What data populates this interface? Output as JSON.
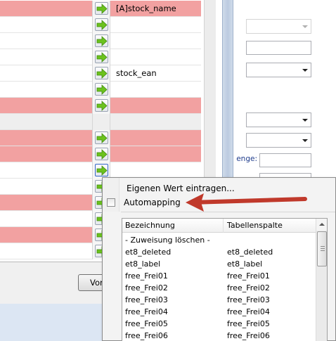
{
  "mapping_grid": {
    "rows": [
      {
        "style": "pink",
        "has_arrow": true,
        "focused": false,
        "target": "[A]stock_name"
      },
      {
        "style": "white",
        "has_arrow": true,
        "focused": false,
        "target": ""
      },
      {
        "style": "white",
        "has_arrow": true,
        "focused": false,
        "target": ""
      },
      {
        "style": "white",
        "has_arrow": true,
        "focused": false,
        "target": ""
      },
      {
        "style": "white",
        "has_arrow": true,
        "focused": false,
        "target": "stock_ean"
      },
      {
        "style": "white",
        "has_arrow": true,
        "focused": false,
        "target": ""
      },
      {
        "style": "pink",
        "has_arrow": true,
        "focused": false,
        "target": ""
      },
      {
        "style": "gray",
        "has_arrow": false,
        "focused": false,
        "target": ""
      },
      {
        "style": "pink",
        "has_arrow": true,
        "focused": false,
        "target": ""
      },
      {
        "style": "pink",
        "has_arrow": true,
        "focused": false,
        "target": ""
      },
      {
        "style": "white",
        "has_arrow": true,
        "focused": true,
        "target": ""
      },
      {
        "style": "white",
        "has_arrow": true,
        "focused": false,
        "target": ""
      },
      {
        "style": "pink",
        "has_arrow": true,
        "focused": false,
        "target": ""
      },
      {
        "style": "white",
        "has_arrow": true,
        "focused": false,
        "target": ""
      },
      {
        "style": "pink",
        "has_arrow": true,
        "focused": false,
        "target": ""
      },
      {
        "style": "white",
        "has_arrow": true,
        "focused": false,
        "target": ""
      }
    ],
    "colors": {
      "unmapped_row": "#f2a1a1",
      "section_row": "#eeeeee",
      "arrow_green": "#6cc21d"
    },
    "arrow_icon": "arrow-right-icon"
  },
  "buttons": {
    "vor_label": "Vor"
  },
  "right_panel": {
    "menge_label": "enge:"
  },
  "popup": {
    "menu": {
      "custom_value_label": "Eigenen Wert eintragen...",
      "automapping_label": "Automapping",
      "automapping_checked": false
    },
    "list": {
      "header_name": "Bezeichnung",
      "header_column": "Tabellenspalte",
      "rows": [
        {
          "name": "- Zuweisung löschen -",
          "column": ""
        },
        {
          "name": "et8_deleted",
          "column": "et8_deleted"
        },
        {
          "name": "et8_label",
          "column": "et8_label"
        },
        {
          "name": "free_Frei01",
          "column": "free_Frei01"
        },
        {
          "name": "free_Frei02",
          "column": "free_Frei02"
        },
        {
          "name": "free_Frei03",
          "column": "free_Frei03"
        },
        {
          "name": "free_Frei04",
          "column": "free_Frei04"
        },
        {
          "name": "free_Frei05",
          "column": "free_Frei05"
        },
        {
          "name": "free_Frei06",
          "column": "free_Frei06"
        }
      ]
    }
  },
  "annotation": {
    "arrow_color": "#c0392b"
  }
}
